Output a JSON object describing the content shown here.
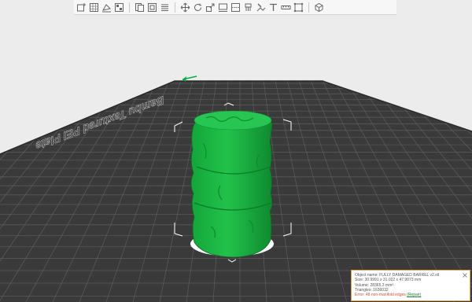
{
  "toolbar": {
    "groups": [
      [
        "add-object",
        "add-plate",
        "auto-orient",
        "arrange",
        "split-objects",
        "split-parts",
        "variable-layer-height"
      ],
      [
        "move",
        "rotate",
        "scale",
        "lay-on-face",
        "cut",
        "support-paint",
        "seam-paint",
        "text",
        "measure",
        "assembly"
      ],
      [
        "view-settings"
      ]
    ]
  },
  "plate": {
    "brand_text": "Bambu Textured PEI Plate"
  },
  "info": {
    "object_name_label": "Object name:",
    "object_name": "FULLY DAMAGED BARREL v2.stl",
    "size_label": "Size:",
    "size": "30.9991 x 31.022 x 47.9073 mm",
    "volume_label": "Volume:",
    "volume": "28365.3 mm³",
    "triangles_label": "Triangles:",
    "triangles": "1636032",
    "error_label": "Error:",
    "error": "48 non-manifold edges",
    "repair_label": "(Repair)"
  },
  "colors": {
    "model": "#1fb343",
    "model_dark": "#0f7a29",
    "plate": "#3b3b3b",
    "grid": "#5f5f5f",
    "accent": "#00ae42",
    "error": "#d94a3a"
  }
}
